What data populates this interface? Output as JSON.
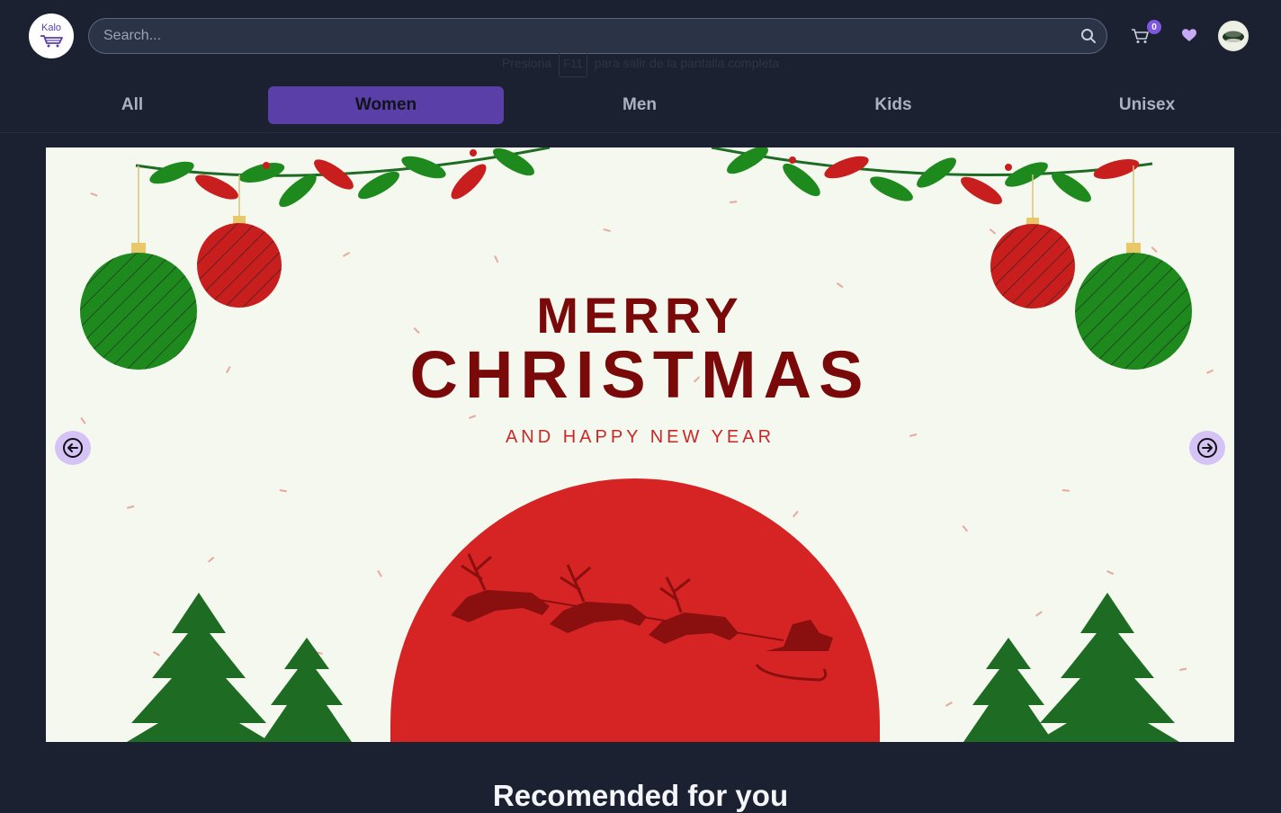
{
  "header": {
    "logo_text": "Kalo",
    "search_placeholder": "Search...",
    "cart_count": "0"
  },
  "fullscreen_hint": {
    "before": "Presiona",
    "key": "F11",
    "after": "para salir de la pantalla completa"
  },
  "tabs": [
    {
      "label": "All",
      "active": false
    },
    {
      "label": "Women",
      "active": true
    },
    {
      "label": "Men",
      "active": false
    },
    {
      "label": "Kids",
      "active": false
    },
    {
      "label": "Unisex",
      "active": false
    }
  ],
  "banner": {
    "line1": "MERRY",
    "line2": "CHRISTMAS",
    "line3": "AND HAPPY NEW YEAR"
  },
  "section_title": "Recomended for you",
  "colors": {
    "background": "#1b2130",
    "accent": "#5a3fa8",
    "banner_bg": "#f4f8ee",
    "banner_title": "#7a0a0a",
    "banner_red": "#d62424",
    "banner_green": "#1e8a1e"
  },
  "icons": [
    "search-icon",
    "cart-icon",
    "heart-icon",
    "arrow-left-icon",
    "arrow-right-icon"
  ]
}
